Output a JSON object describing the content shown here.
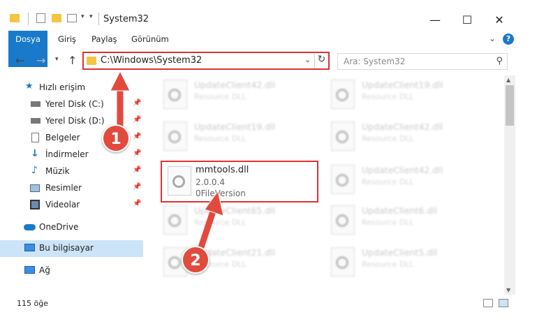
{
  "window": {
    "title": "System32",
    "minimize": "—",
    "maximize": "☐",
    "close": "✕"
  },
  "ribbon": {
    "tabs": [
      "Dosya",
      "Giriş",
      "Paylaş",
      "Görünüm"
    ],
    "help": "?"
  },
  "address": {
    "path": "C:\\Windows\\System32",
    "search_placeholder": "Ara: System32"
  },
  "sidebar": {
    "items": [
      {
        "label": "Hızlı erişim",
        "icon": "star-icon"
      },
      {
        "label": "Yerel Disk (C:)",
        "icon": "drive-icon"
      },
      {
        "label": "Yerel Disk (D:)",
        "icon": "drive-icon"
      },
      {
        "label": "Belgeler",
        "icon": "documents-icon"
      },
      {
        "label": "İndirmeler",
        "icon": "download-icon"
      },
      {
        "label": "Müzik",
        "icon": "music-icon"
      },
      {
        "label": "Resimler",
        "icon": "pictures-icon"
      },
      {
        "label": "Videolar",
        "icon": "videos-icon"
      },
      {
        "label": "OneDrive",
        "icon": "cloud-icon"
      },
      {
        "label": "Bu bilgisayar",
        "icon": "computer-icon"
      },
      {
        "label": "Ağ",
        "icon": "network-icon"
      }
    ]
  },
  "files": {
    "blurred": [
      {
        "name": "UpdateClient42.dll",
        "desc": "Resource DLL"
      },
      {
        "name": "UpdateClient19.dll",
        "desc": "Resource DLL"
      },
      {
        "name": "UpdateClient19.dll",
        "desc": "Resource DLL"
      },
      {
        "name": "UpdateClient42.dll",
        "desc": "Resource DLL"
      },
      {
        "name": "UpdateClient42.dll",
        "desc": "Resource DLL"
      },
      {
        "name": "UpdateClient65.dll",
        "desc": "Resource DLL"
      },
      {
        "name": "UpdateClient6.dll",
        "desc": "Resource DLL"
      },
      {
        "name": "UpdateClient21.dll",
        "desc": "Resource DLL"
      },
      {
        "name": "UpdateClient5.dll",
        "desc": "Resource DLL"
      }
    ],
    "highlighted": {
      "name": "mmtools.dll",
      "version": "2.0.0.4",
      "file_version": "0FileVersion"
    }
  },
  "status": {
    "count": "115 öğe"
  },
  "callouts": {
    "one": "1",
    "two": "2"
  },
  "colors": {
    "accent": "#1979ca",
    "callout": "#e24a3e",
    "highlight_border": "#e03030",
    "selection": "#cce4f7"
  }
}
